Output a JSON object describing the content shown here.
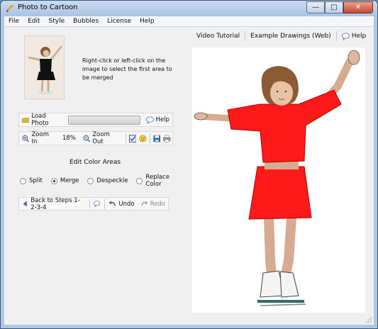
{
  "window": {
    "title": "Photo to Cartoon",
    "min": "—",
    "max": "□",
    "close": "✕"
  },
  "menu": [
    "File",
    "Edit",
    "Style",
    "Bubbles",
    "License",
    "Help"
  ],
  "instructions": "Right-click or left-click on the image to select the first area to be merged",
  "load_toolbar": {
    "load": "Load Photo",
    "help": "Help"
  },
  "zoom_toolbar": {
    "zoom_in": "Zoom In",
    "zoom_level": "18%",
    "zoom_out": "Zoom Out"
  },
  "edit": {
    "title": "Edit Color Areas",
    "options": [
      "Split",
      "Merge",
      "Despeckle",
      "Replace Color"
    ],
    "selected": "Merge"
  },
  "nav_toolbar": {
    "back": "Back to Steps 1-2-3-4",
    "undo": "Undo",
    "redo": "Redo"
  },
  "tabs": {
    "video": "Video Tutorial",
    "examples": "Example Drawings (Web)",
    "help": "Help"
  },
  "colors": {
    "accent": "#1f6fbf",
    "skirt": "#ff1a1a",
    "skin": "#d8ab90",
    "hair": "#8c5a33"
  }
}
